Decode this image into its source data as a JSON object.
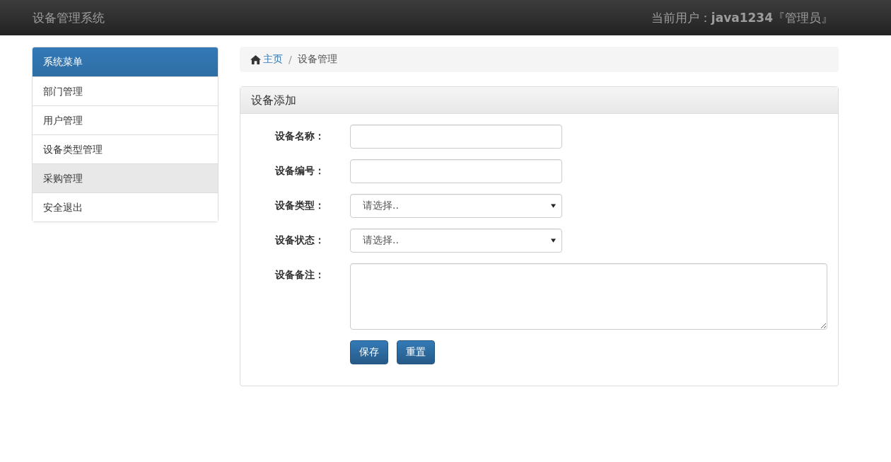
{
  "header": {
    "title": "设备管理系统",
    "user": "当前用户：**java1234**『管理员』"
  },
  "sidebar": {
    "heading": "系统菜单",
    "items": [
      {
        "label": "部门管理",
        "selected": false
      },
      {
        "label": "用户管理",
        "selected": false
      },
      {
        "label": "设备类型管理",
        "selected": false
      },
      {
        "label": "采购管理",
        "selected": true
      },
      {
        "label": "安全退出",
        "selected": false
      }
    ]
  },
  "breadcrumb": {
    "items": [
      {
        "label": "主页",
        "kind": "link"
      },
      {
        "label": "设备管理",
        "kind": "current"
      }
    ],
    "separator": "/"
  },
  "panel": {
    "title": "设备添加",
    "fields": [
      {
        "label": "设备名称：",
        "kind": "text"
      },
      {
        "label": "设备编号：",
        "kind": "text"
      },
      {
        "label": "设备类型：",
        "kind": "select",
        "value": "请选择.."
      },
      {
        "label": "设备状态：",
        "kind": "select",
        "value": "请选择.."
      },
      {
        "label": "设备备注：",
        "kind": "textarea"
      }
    ],
    "buttons": [
      "保存",
      "重置"
    ]
  }
}
